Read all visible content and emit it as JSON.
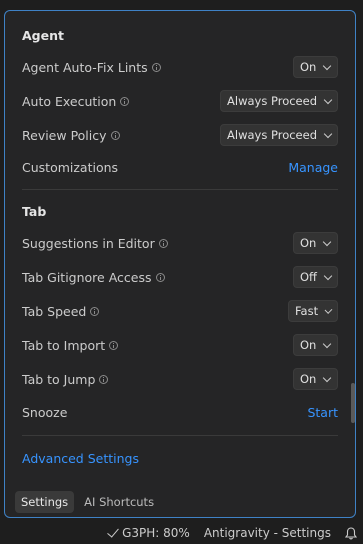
{
  "agent": {
    "title": "Agent",
    "rows": [
      {
        "label": "Agent Auto-Fix Lints",
        "value": "On"
      },
      {
        "label": "Auto Execution",
        "value": "Always Proceed"
      },
      {
        "label": "Review Policy",
        "value": "Always Proceed"
      },
      {
        "label": "Customizations",
        "link": "Manage"
      }
    ]
  },
  "tab": {
    "title": "Tab",
    "rows": [
      {
        "label": "Suggestions in Editor",
        "value": "On"
      },
      {
        "label": "Tab Gitignore Access",
        "value": "Off"
      },
      {
        "label": "Tab Speed",
        "value": "Fast"
      },
      {
        "label": "Tab to Import",
        "value": "On"
      },
      {
        "label": "Tab to Jump",
        "value": "On"
      },
      {
        "label": "Snooze",
        "link": "Start"
      }
    ]
  },
  "advanced_link": "Advanced Settings",
  "bottom_tabs": [
    "Settings",
    "AI Shortcuts"
  ],
  "statusbar": {
    "g3ph": "G3PH: 80%",
    "app": "Antigravity - Settings"
  }
}
